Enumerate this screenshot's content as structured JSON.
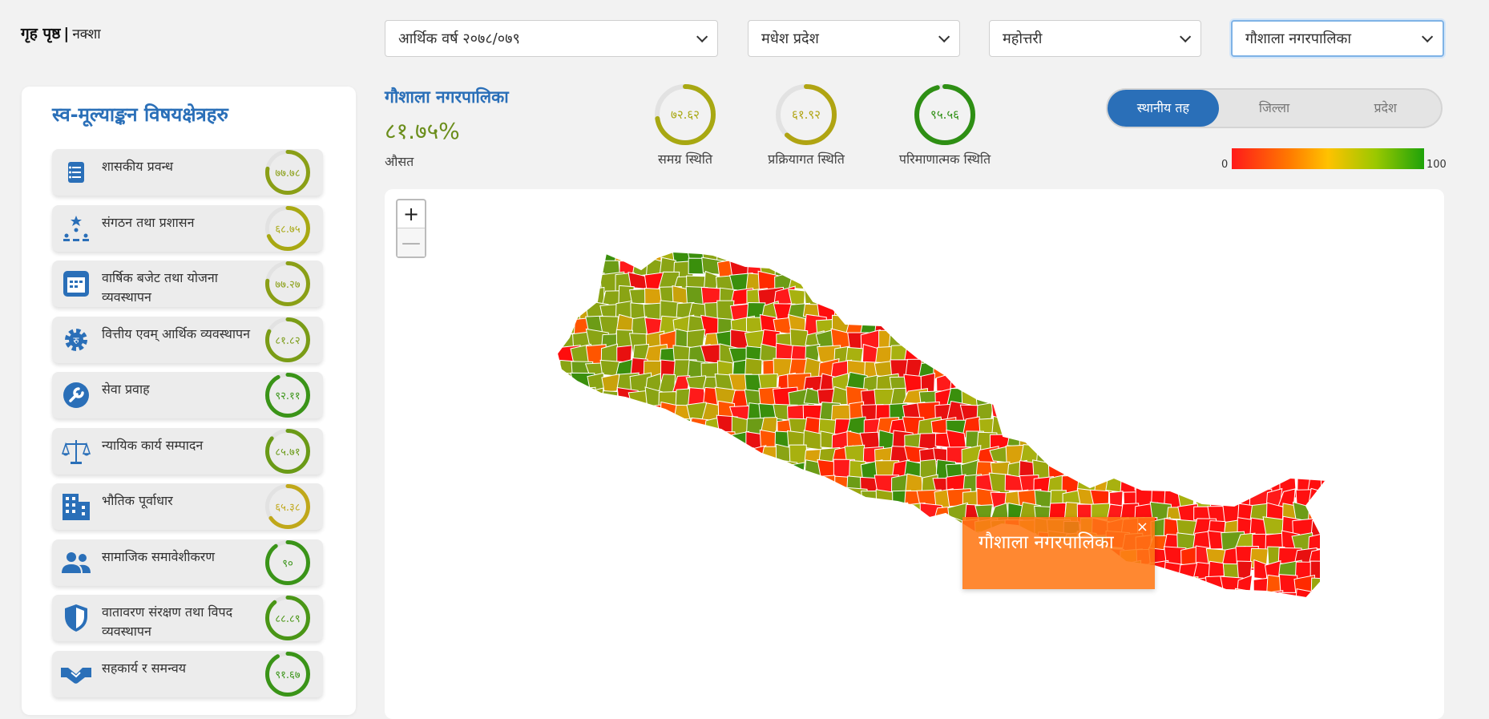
{
  "breadcrumb": {
    "home": "गृह पृष्ठ",
    "separator": "|",
    "current": "नक्शा"
  },
  "filters": {
    "fiscal_year": "आर्थिक वर्ष २०७८/०७९",
    "province": "मधेश प्रदेश",
    "district": "महोत्तरी",
    "municipality": "गौशाला नगरपालिका"
  },
  "sidebar": {
    "title": "स्व-मूल्याङ्कन विषयक्षेत्रहरु",
    "items": [
      {
        "label": "शासकीय प्रवन्ध",
        "value": "७७.७८",
        "pct": 77.78,
        "icon": "checklist-icon",
        "color": "#8a9f16"
      },
      {
        "label": "संगठन तथा प्रशासन",
        "value": "६८.७५",
        "pct": 68.75,
        "icon": "org-chart-icon",
        "color": "#a8a812"
      },
      {
        "label": "वार्षिक बजेट तथा योजना व्यवस्थापन",
        "value": "७७.२७",
        "pct": 77.27,
        "icon": "calendar-icon",
        "color": "#8a9f16"
      },
      {
        "label": "वित्तीय एवम् आर्थिक व्यवस्थापन",
        "value": "८१.८२",
        "pct": 81.82,
        "icon": "gear-rupee-icon",
        "color": "#7a9c16"
      },
      {
        "label": "सेवा प्रवाह",
        "value": "९२.११",
        "pct": 92.11,
        "icon": "wrench-icon",
        "color": "#3a9418"
      },
      {
        "label": "न्यायिक कार्य सम्पादन",
        "value": "८५.७१",
        "pct": 85.71,
        "icon": "scales-icon",
        "color": "#6a9a16"
      },
      {
        "label": "भौतिक पूर्वाधार",
        "value": "६५.३८",
        "pct": 65.38,
        "icon": "building-icon",
        "color": "#c0a81a"
      },
      {
        "label": "सामाजिक समावेशीकरण",
        "value": "९०",
        "pct": 90,
        "icon": "people-icon",
        "color": "#3a9418"
      },
      {
        "label": "वातावरण संरक्षण तथा विपद व्यवस्थापन",
        "value": "८८.८९",
        "pct": 88.89,
        "icon": "shield-icon",
        "color": "#4a9616"
      },
      {
        "label": "सहकार्य र समन्वय",
        "value": "९१.६७",
        "pct": 91.67,
        "icon": "handshake-icon",
        "color": "#3a9418"
      }
    ]
  },
  "summary": {
    "title": "गौशाला नगरपालिका",
    "average": "८१.७५%",
    "average_label": "औसत",
    "stats": [
      {
        "label": "समग्र स्थिति",
        "value": "७२.६२",
        "pct": 72.62,
        "color": "#a8a812"
      },
      {
        "label": "प्रक्रियागत स्थिति",
        "value": "६१.९२",
        "pct": 61.92,
        "color": "#b0a412"
      },
      {
        "label": "परिमाणात्मक स्थिति",
        "value": "९५.५६",
        "pct": 95.56,
        "color": "#2e8f14"
      }
    ]
  },
  "toggle": {
    "options": [
      "स्थानीय तह",
      "जिल्ला",
      "प्रदेश"
    ],
    "active": "स्थानीय तह"
  },
  "legend": {
    "min": "0",
    "max": "100"
  },
  "map": {
    "zoom_in": "+",
    "zoom_out": "—",
    "popup_title": "गौशाला नगरपालिका",
    "popup_close": "×"
  }
}
